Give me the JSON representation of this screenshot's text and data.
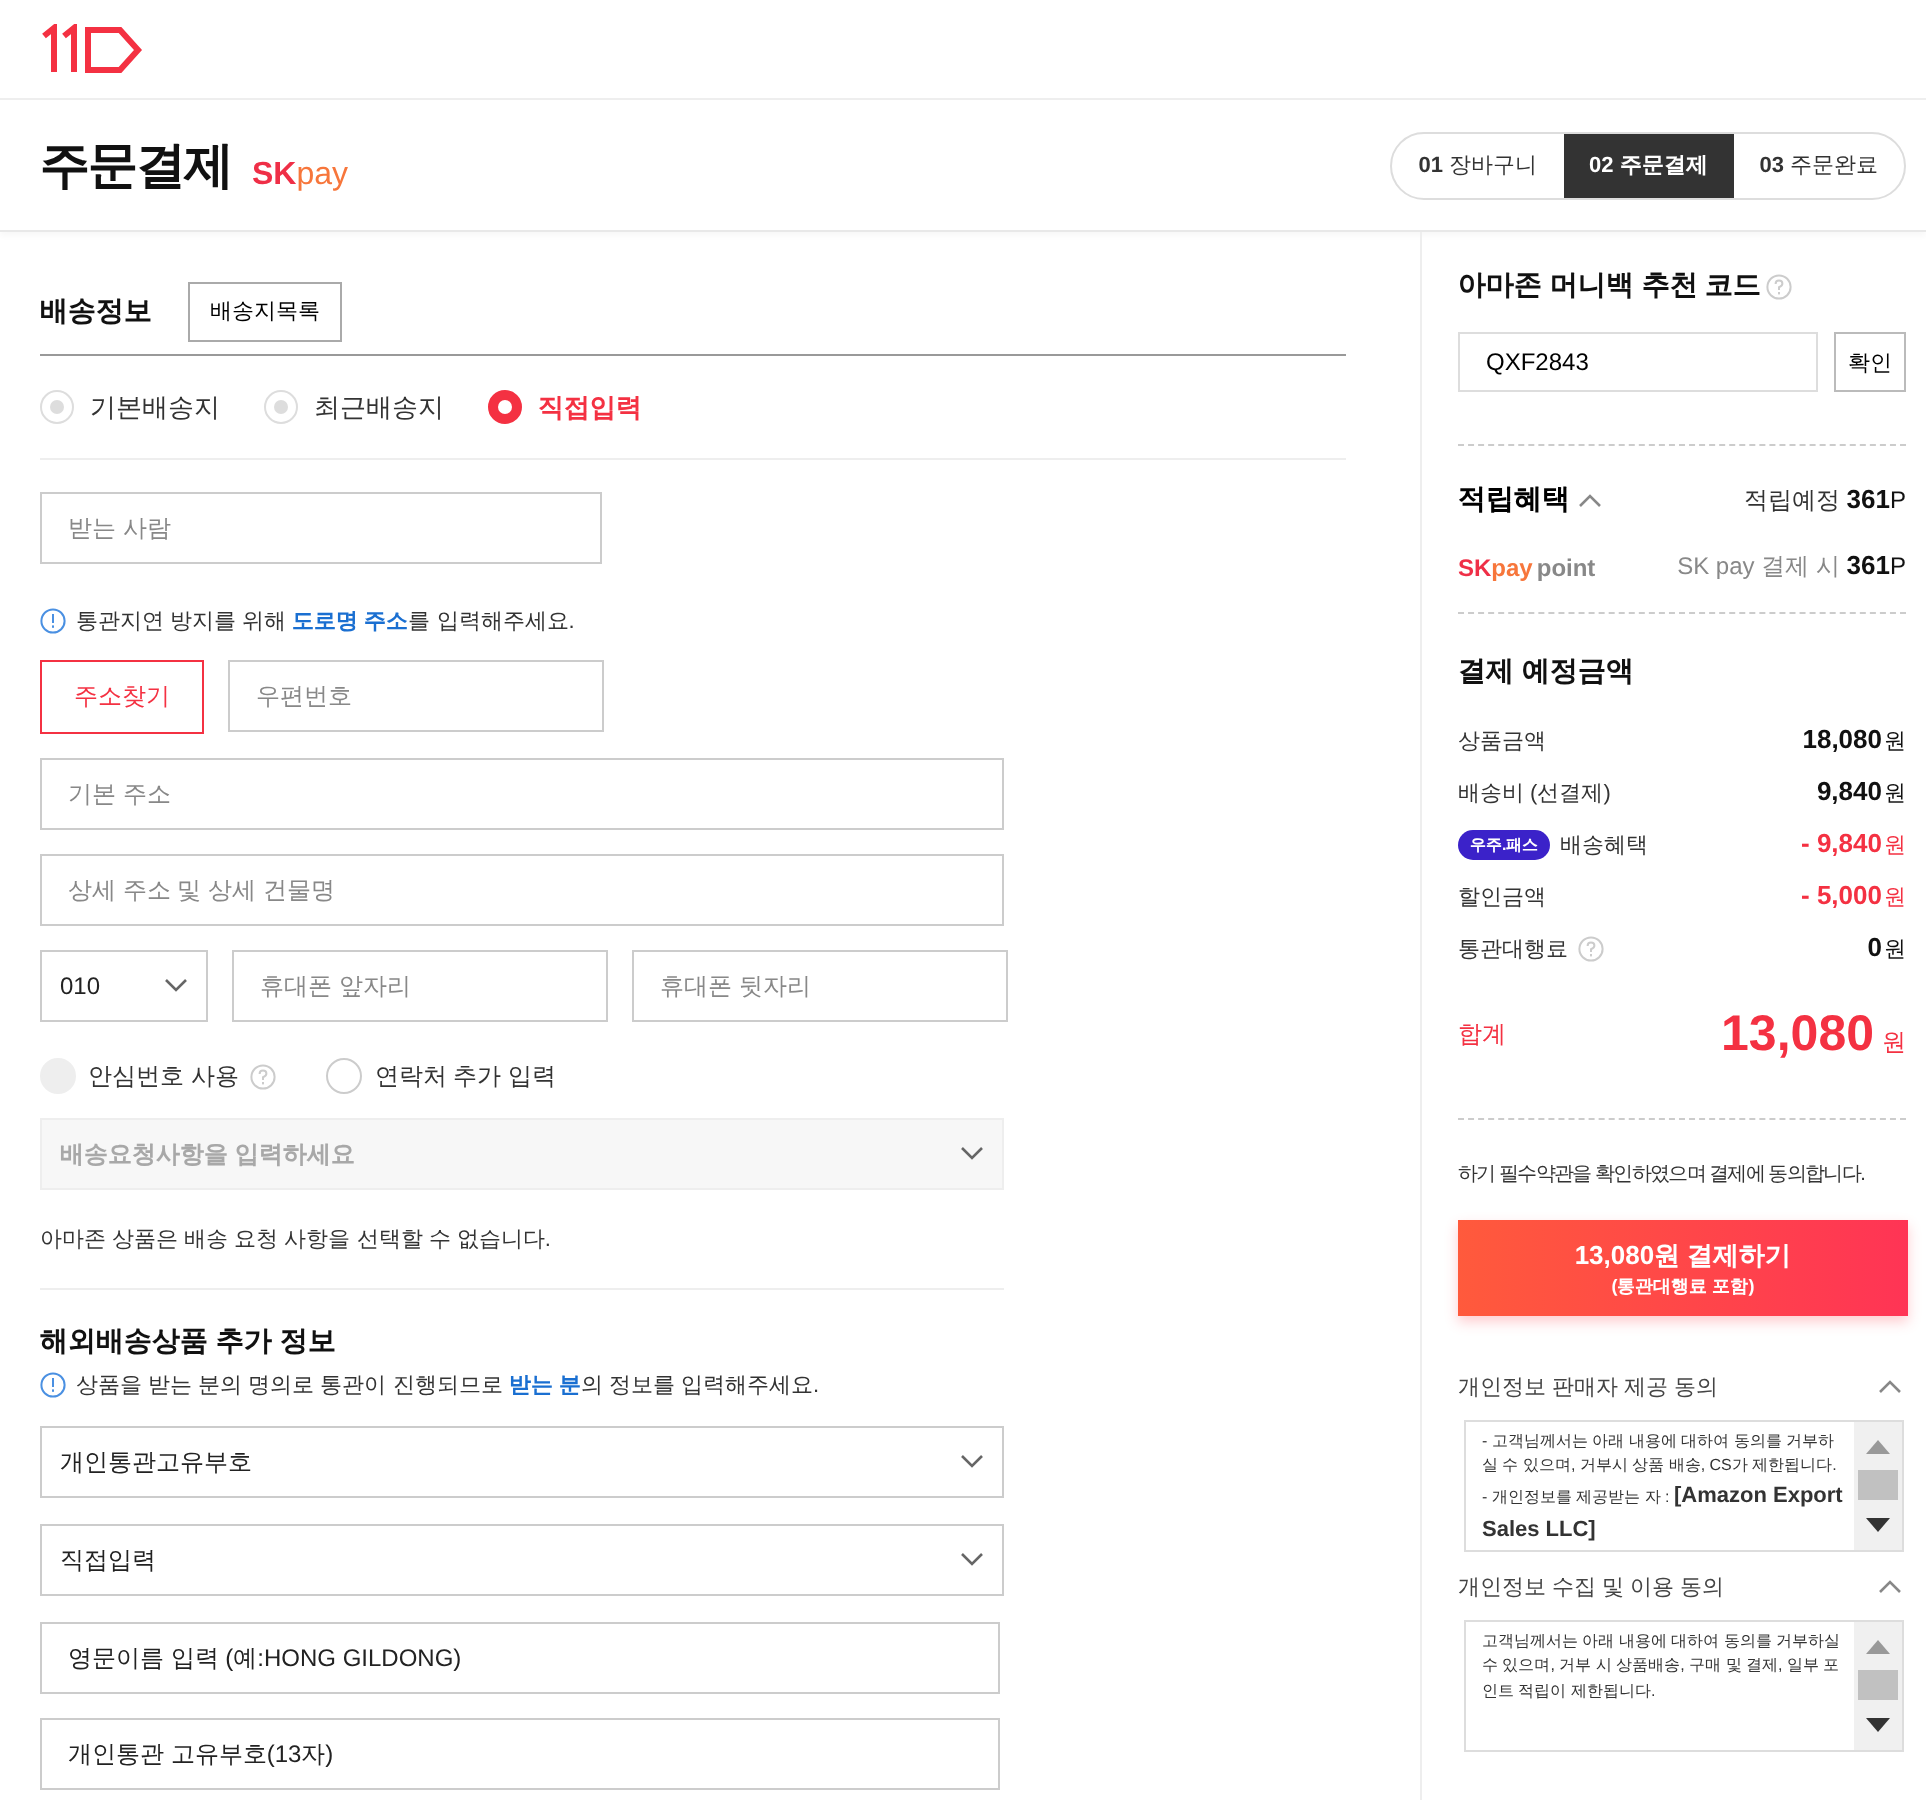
{
  "header": {
    "page_title": "주문결제",
    "pay_logo": [
      "SK",
      "pay"
    ]
  },
  "steps": [
    {
      "number": "01",
      "label": "장바구니",
      "selected": false
    },
    {
      "number": "02",
      "label": "주문결제",
      "selected": true
    },
    {
      "number": "03",
      "label": "주문완료",
      "selected": false
    }
  ],
  "shipping": {
    "title": "배송정보",
    "list_button": "배송지목록",
    "options": [
      {
        "label": "기본배송지",
        "selected": false
      },
      {
        "label": "최근배송지",
        "selected": false
      },
      {
        "label": "직접입력",
        "selected": true
      }
    ],
    "recipient": {
      "placeholder": "받는 사람"
    },
    "notice": "통관지연 방지를 위해 **도로명 주소**를 입력해주세요.",
    "address_button": "주소찾기",
    "postcode": {
      "placeholder": "우편번호"
    },
    "base_address": {
      "placeholder": "기본 주소"
    },
    "detail_address": {
      "placeholder": "상세 주소 및 상세 건물명"
    },
    "phone": {
      "prefix": "010",
      "front": {
        "placeholder": "휴대폰 앞자리"
      },
      "back": {
        "placeholder": "휴대폰 뒷자리"
      }
    },
    "checks": [
      {
        "label": "안심번호 사용",
        "checked": false,
        "disabled": true,
        "help": true
      },
      {
        "label": "연락처 추가 입력",
        "checked": false,
        "disabled": false,
        "help": false
      }
    ],
    "request": {
      "placeholder": "배송요청사항을 입력하세요",
      "disabled": true
    },
    "request_note": "아마존 상품은 배송 요청 사항을 선택할 수 없습니다."
  },
  "overseas": {
    "title": "해외배송상품 추가 정보",
    "notice": "상품을 받는 분의 명의로 통관이 진행되므로 **받는 분**의 정보를 입력해주세요.",
    "selects": [
      {
        "value": "개인통관고유부호"
      },
      {
        "value": "직접입력"
      }
    ],
    "inputs": [
      {
        "placeholder": "영문이름 입력 (예:HONG GILDONG)"
      },
      {
        "placeholder": "개인통관 고유부호(13자)"
      }
    ]
  },
  "referral": {
    "title": "아마존 머니백 추천 코드",
    "value": "QXF2843",
    "button": "확인"
  },
  "points": {
    "title": "적립혜택",
    "expanded": true,
    "expected_label": "적립예정",
    "expected_value": "361",
    "unit": "P",
    "skpay_logo": [
      "SK",
      "pay",
      "point"
    ],
    "skpay_label": "SK pay 결제 시",
    "skpay_value": "361",
    "skpay_unit": "P"
  },
  "payment": {
    "title": "결제 예정금액",
    "rows": [
      {
        "label": "상품금액",
        "amount": "18,080",
        "unit": "원",
        "kind": "plain",
        "help": false
      },
      {
        "label": "배송비 (선결제)",
        "amount": "9,840",
        "unit": "원",
        "kind": "plain",
        "help": false
      },
      {
        "label": "배송혜택",
        "badge": "우주.패스",
        "amount": "- 9,840",
        "unit": "원",
        "kind": "discount",
        "help": false
      },
      {
        "label": "할인금액",
        "amount": "- 5,000",
        "unit": "원",
        "kind": "discount",
        "help": false
      },
      {
        "label": "통관대행료",
        "amount": "0",
        "unit": "원",
        "kind": "plain",
        "help": true
      }
    ],
    "total_label": "합계",
    "total_amount": "13,080",
    "total_unit": "원"
  },
  "agree_text": "하기 필수약관을 확인하였으며 결제에 동의합니다.",
  "pay_button": {
    "label": "13,080원 결제하기",
    "sub": "(통관대행료 포함)"
  },
  "agreements": [
    {
      "title": "개인정보 판매자 제공 동의",
      "expanded": true,
      "lines": [
        "- 고객님께서는 아래 내용에 대하여 동의를 거부하실 수 있으며, 거부시 상품 배송, CS가 제한됩니다.",
        "- 개인정보를 제공받는 자 : **[Amazon Export Sales LLC]**"
      ]
    },
    {
      "title": "개인정보 수집 및 이용 동의",
      "expanded": true,
      "lines": [
        "고객님께서는 아래 내용에 대하여 동의를 거부하실 수 있으며, 거부 시 상품배송, 구매 및 결제, 일부 포인트 적립이 제한됩니다."
      ]
    }
  ]
}
